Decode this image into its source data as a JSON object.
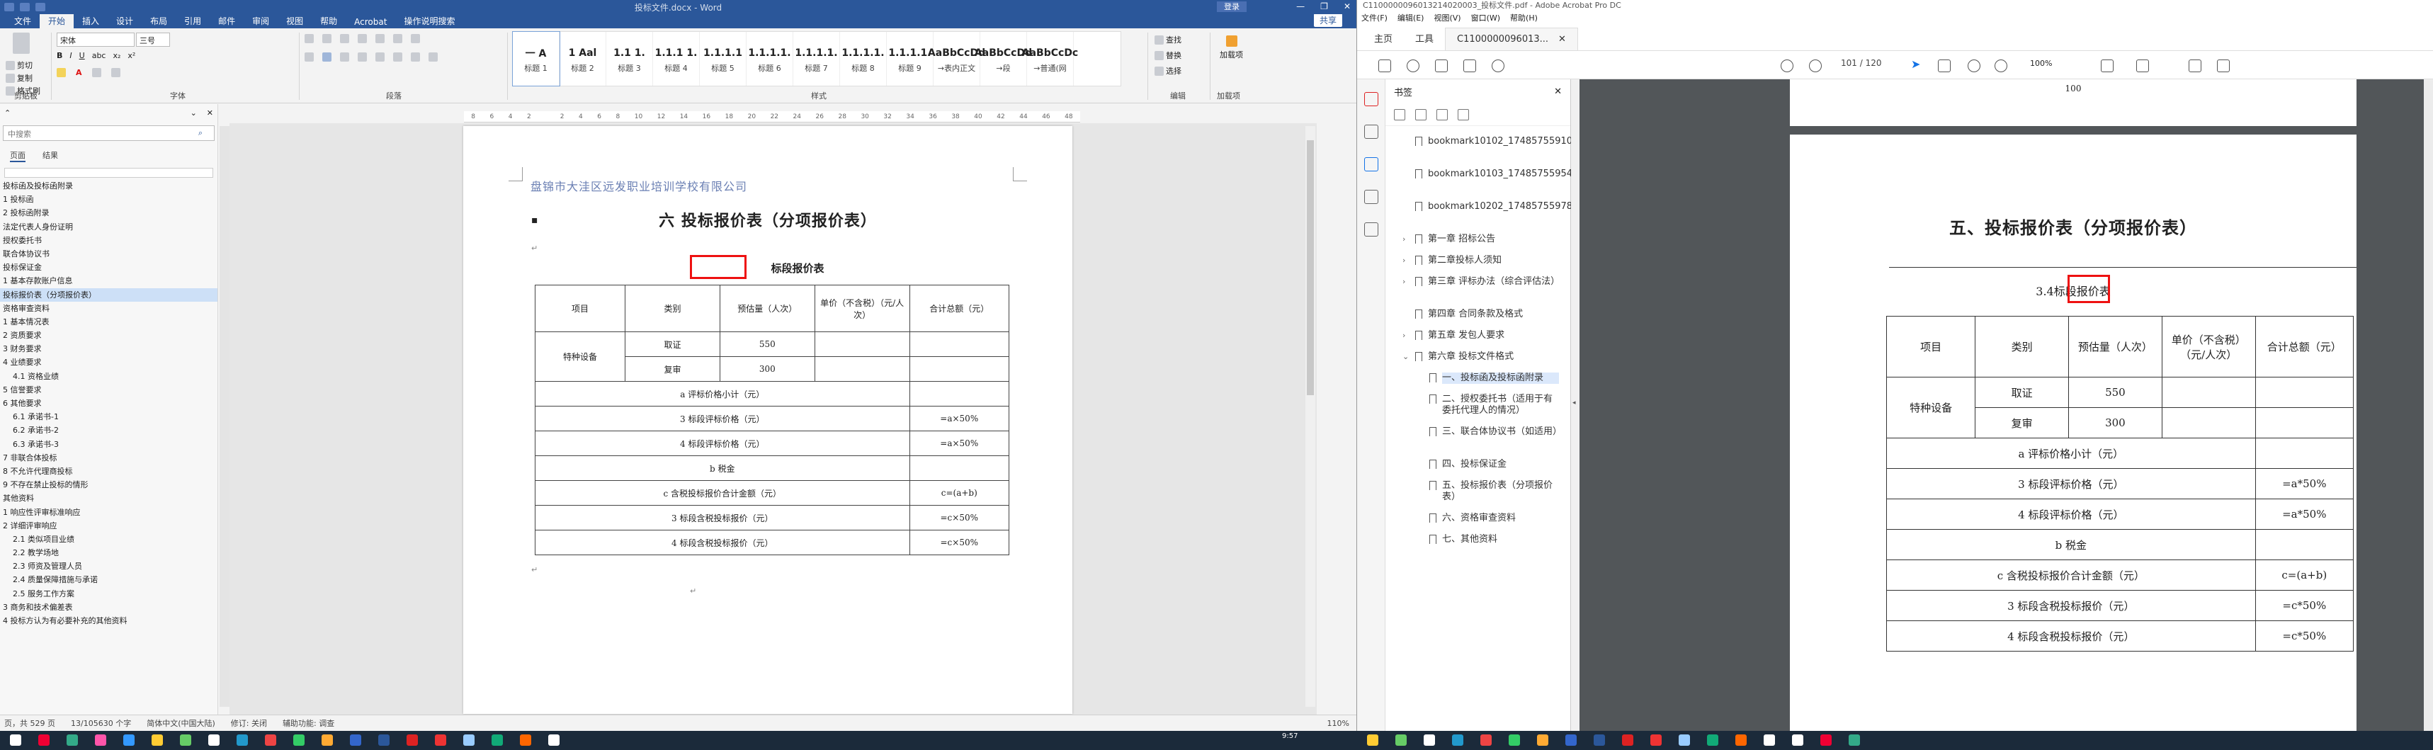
{
  "word": {
    "title": "投标文件.docx - Word",
    "login": "登录",
    "menu": [
      "文件",
      "开始",
      "插入",
      "设计",
      "布局",
      "引用",
      "邮件",
      "审阅",
      "视图",
      "帮助",
      "Acrobat",
      "操作说明搜索"
    ],
    "share": "共享",
    "clipboard": {
      "cut": "剪切",
      "copy": "复制",
      "format": "格式刷",
      "label": "剪贴板"
    },
    "font": {
      "name": "宋体",
      "size": "三号",
      "label": "字体"
    },
    "paragraph_label": "段落",
    "styles": [
      {
        "sample": "一  A",
        "name": "标题 1"
      },
      {
        "sample": "1  Aal",
        "name": "标题 2"
      },
      {
        "sample": "1.1  1.",
        "name": "标题 3"
      },
      {
        "sample": "1.1.1  1.",
        "name": "标题 4"
      },
      {
        "sample": "1.1.1.1",
        "name": "标题 5"
      },
      {
        "sample": "1.1.1.1.",
        "name": "标题 6"
      },
      {
        "sample": "1.1.1.1.",
        "name": "标题 7"
      },
      {
        "sample": "1.1.1.1.",
        "name": "标题 8"
      },
      {
        "sample": "1.1.1.1.",
        "name": "标题 9"
      },
      {
        "sample": "AaBbCcDd",
        "name": "→表内正文"
      },
      {
        "sample": "AaBbCcDd",
        "name": "→段"
      },
      {
        "sample": "AaBbCcDc",
        "name": "→普通(网"
      }
    ],
    "styles_label": "样式",
    "editing": {
      "find": "查找",
      "replace": "替换",
      "select": "选择",
      "label": "编辑"
    },
    "addin": {
      "name": "加载项",
      "label": "加载项"
    },
    "nav": {
      "search_placeholder": "中搜索",
      "tabs": [
        "页面",
        "结果"
      ],
      "items": [
        {
          "t": "投标函及投标函附录",
          "lvl": 1
        },
        {
          "t": "1 投标函",
          "lvl": 1
        },
        {
          "t": "2 投标函附录",
          "lvl": 1
        },
        {
          "t": "法定代表人身份证明",
          "lvl": 1
        },
        {
          "t": "授权委托书",
          "lvl": 1
        },
        {
          "t": "联合体协议书",
          "lvl": 1
        },
        {
          "t": "投标保证金",
          "lvl": 1
        },
        {
          "t": "1 基本存款账户信息",
          "lvl": 1
        },
        {
          "t": "投标报价表（分项报价表）",
          "lvl": 1,
          "sel": true
        },
        {
          "t": "资格审查资料",
          "lvl": 1
        },
        {
          "t": "1 基本情况表",
          "lvl": 1
        },
        {
          "t": "2 资质要求",
          "lvl": 1
        },
        {
          "t": "3 财务要求",
          "lvl": 1
        },
        {
          "t": "4 业绩要求",
          "lvl": 1
        },
        {
          "t": "4.1 资格业绩",
          "lvl": 2
        },
        {
          "t": "5 信誉要求",
          "lvl": 1
        },
        {
          "t": "6 其他要求",
          "lvl": 1
        },
        {
          "t": "6.1 承诺书-1",
          "lvl": 2
        },
        {
          "t": "6.2 承诺书-2",
          "lvl": 2
        },
        {
          "t": "6.3 承诺书-3",
          "lvl": 2
        },
        {
          "t": "7 非联合体投标",
          "lvl": 1
        },
        {
          "t": "8 不允许代理商投标",
          "lvl": 1
        },
        {
          "t": "9 不存在禁止投标的情形",
          "lvl": 1
        },
        {
          "t": "其他资料",
          "lvl": 1
        },
        {
          "t": "1 响应性评审标准响应",
          "lvl": 1
        },
        {
          "t": "2 详细评审响应",
          "lvl": 1
        },
        {
          "t": "2.1 类似项目业绩",
          "lvl": 2
        },
        {
          "t": "2.2 教学场地",
          "lvl": 2
        },
        {
          "t": "2.3 师资及管理人员",
          "lvl": 2
        },
        {
          "t": "2.4 质量保障措施与承诺",
          "lvl": 2
        },
        {
          "t": "2.5 服务工作方案",
          "lvl": 2
        },
        {
          "t": "3 商务和技术偏差表",
          "lvl": 1
        },
        {
          "t": "4 投标方认为有必要补充的其他资料",
          "lvl": 1
        }
      ]
    },
    "ruler_ticks": [
      "8",
      "6",
      "4",
      "2",
      "",
      "2",
      "4",
      "6",
      "8",
      "10",
      "12",
      "14",
      "16",
      "18",
      "20",
      "22",
      "24",
      "26",
      "28",
      "30",
      "32",
      "34",
      "36",
      "38",
      "40",
      "42",
      "44",
      "46",
      "48"
    ],
    "doc": {
      "header": "盘锦市大洼区远发职业培训学校有限公司",
      "title": "六 投标报价表（分项报价表）",
      "subtitle": "标段报价表",
      "table": {
        "h1": "项目",
        "h2": "类别",
        "h3": "预估量（人次）",
        "h4": "单价（不含税）（元/人次）",
        "h5": "合计总额（元）",
        "proj": "特种设备",
        "r1": {
          "cat": "取证",
          "qty": "550"
        },
        "r2": {
          "cat": "复审",
          "qty": "300"
        },
        "rows": [
          {
            "label": "a 评标价格小计（元）",
            "val": ""
          },
          {
            "label": "3 标段评标价格（元）",
            "val": "=a×50%"
          },
          {
            "label": "4 标段评标价格（元）",
            "val": "=a×50%"
          },
          {
            "label": "b 税金",
            "val": ""
          },
          {
            "label": "c 含税投标报价合计金额（元）",
            "val": "c=(a+b)"
          },
          {
            "label": "3 标段含税投标报价（元）",
            "val": "=c×50%"
          },
          {
            "label": "4 标段含税投标报价（元）",
            "val": "=c×50%"
          }
        ]
      }
    },
    "status": {
      "page": "页，共 529 页",
      "words": "13/105630 个字",
      "lang": "简体中文(中国大陆)",
      "track": "修订: 关闭",
      "access": "辅助功能: 调查",
      "zoom": "110%"
    }
  },
  "acrobat": {
    "title": "C1100000096013214020003_投标文件.pdf - Adobe Acrobat Pro DC",
    "menu": [
      "文件(F)",
      "编辑(E)",
      "视图(V)",
      "窗口(W)",
      "帮助(H)"
    ],
    "tabs": [
      "主页",
      "工具"
    ],
    "doc_tab": "C1100000096013...",
    "page_current": "101",
    "page_total": "/ 120",
    "zoom": "100%",
    "bookmarks_label": "书签",
    "bookmarks": [
      {
        "t": "bookmark10102_1748575591023"
      },
      {
        "t": "bookmark10103_1748575595434"
      },
      {
        "t": "bookmark10202_1748575597850"
      },
      {
        "t": "第一章 招标公告",
        "caret": "›"
      },
      {
        "t": "第二章投标人须知",
        "caret": "›"
      },
      {
        "t": "第三章 评标办法（综合评估法）",
        "caret": "›"
      },
      {
        "t": "第四章 合同条款及格式"
      },
      {
        "t": "第五章 发包人要求",
        "caret": "›"
      },
      {
        "t": "第六章 投标文件格式",
        "caret": "⌄"
      },
      {
        "t": "一、投标函及投标函附录",
        "sel": true
      },
      {
        "t": "二、授权委托书（适用于有委托代理人的情况）"
      },
      {
        "t": "三、联合体协议书（如适用）"
      },
      {
        "t": "四、投标保证金"
      },
      {
        "t": "五、投标报价表（分项报价表）"
      },
      {
        "t": "六、资格审查资料"
      },
      {
        "t": "七、其他资料"
      }
    ],
    "prev_page_number": "100",
    "pdf": {
      "title": "五、投标报价表（分项报价表）",
      "subtitle_num": "3.4",
      "subtitle": "标段报价表",
      "table": {
        "h1": "项目",
        "h2": "类别",
        "h3": "预估量（人次）",
        "h4": "单价（不含税）（元/人次）",
        "h5": "合计总额（元）",
        "proj": "特种设备",
        "r1": {
          "cat": "取证",
          "qty": "550"
        },
        "r2": {
          "cat": "复审",
          "qty": "300"
        },
        "rows": [
          {
            "label": "a 评标价格小计（元）",
            "val": ""
          },
          {
            "label": "3 标段评标价格（元）",
            "val": "=a*50%"
          },
          {
            "label": "4 标段评标价格（元）",
            "val": "=a*50%"
          },
          {
            "label": "b 税金",
            "val": ""
          },
          {
            "label": "c 含税投标报价合计金额（元）",
            "val": "c=(a+b)"
          },
          {
            "label": "3 标段含税投标报价（元）",
            "val": "=c*50%"
          },
          {
            "label": "4 标段含税投标报价（元）",
            "val": "=c*50%"
          }
        ]
      }
    }
  },
  "taskbar": {
    "time": "9:57"
  },
  "colors": {
    "word_blue": "#2b579a",
    "red_box": "#e11111",
    "acrobat_dark": "#525659"
  }
}
